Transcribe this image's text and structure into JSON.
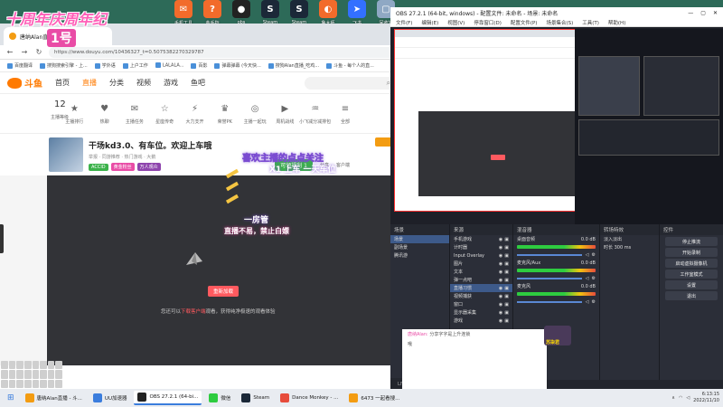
{
  "desktop_icons": [
    {
      "label": "手机工具",
      "color": "#f26b2b",
      "glyph": "✉"
    },
    {
      "label": "金手指",
      "color": "#f26b2b",
      "glyph": "?"
    },
    {
      "label": "obs",
      "color": "#222",
      "glyph": "●"
    },
    {
      "label": "Steam",
      "color": "#1b2838",
      "glyph": "S"
    },
    {
      "label": "Steam",
      "color": "#1b2838",
      "glyph": "S"
    },
    {
      "label": "鲁大师",
      "color": "#f26b2b",
      "glyph": "◐"
    },
    {
      "label": "飞书",
      "color": "#3370ff",
      "glyph": "➤"
    },
    {
      "label": "回收站",
      "color": "#8fa8c4",
      "glyph": "▢"
    }
  ],
  "browser": {
    "overlay_title": "十周年庆周年纪",
    "overlay_badge": "1号",
    "tab_title": "唐纳Alan直播 - 斗鱼",
    "url": "https://www.douyu.com/10436327_t=0.5075382270329787",
    "bookmarks": [
      "百度翻译",
      "搜狗搜索引擎 - 上...",
      "学外语",
      "上户工作",
      "LALALA...",
      "百影",
      "弹幕弹幕 (今天快...",
      "搜狗Alan直播_吃鸡...",
      "斗鱼 - 每个人的直..."
    ]
  },
  "site": {
    "logo": "斗鱼",
    "nav": [
      "首页",
      "直播",
      "分类",
      "视频",
      "游戏",
      "鱼吧"
    ],
    "categories": [
      {
        "label": "主播排行",
        "glyph": "★"
      },
      {
        "label": "热聊",
        "glyph": "♥"
      },
      {
        "label": "主播任务",
        "glyph": "✉"
      },
      {
        "label": "星座传奇",
        "glyph": "☆"
      },
      {
        "label": "大力支开",
        "glyph": "⚡"
      },
      {
        "label": "荣誉PK",
        "glyph": "♛"
      },
      {
        "label": "主播一起玩",
        "glyph": "◎"
      },
      {
        "label": "周机战线",
        "glyph": "▶"
      },
      {
        "label": "小飞减分减排包",
        "glyph": "♒"
      },
      {
        "label": "全部",
        "glyph": "≡"
      }
    ],
    "level_num": "12",
    "level_label": "主播等级"
  },
  "room": {
    "title": "干场kd3.0、有车位。欢迎上车哦",
    "meta1": "举报 · 同游推荐 · 热门游戏 · 大鹅",
    "badges": [
      {
        "text": "ACCID",
        "color": "#3bb24a"
      },
      {
        "text": "黄金粉丝",
        "color": "#e94ca6"
      },
      {
        "text": "万人观众",
        "color": "#8e44ad"
      }
    ],
    "follow_label": "可领福利 1",
    "share": "分享",
    "more": "客户端"
  },
  "player": {
    "play_btn": "重新加载",
    "tip_before": "您还可以",
    "tip_highlight": "下载客户端",
    "tip_after": "观看，获得纯净极速的观看体验"
  },
  "obs": {
    "title": "OBS 27.2.1 (64-bit, windows) - 配置文件: 未命名 - 场景: 未命名",
    "menu": [
      "文件(F)",
      "编辑(E)",
      "视图(V)",
      "停靠窗口(D)",
      "配置文件(P)",
      "场景集合(S)",
      "工具(T)",
      "帮助(H)"
    ],
    "overlay1": "喜欢主播的点点关注",
    "overlay2": "X1 上车 一天车位",
    "overlay3": "一房管",
    "overlay4": "直播不易，禁止白嫖",
    "docks": {
      "scenes_head": "场景",
      "scenes": [
        "场景",
        "副场景",
        "腾讯游"
      ],
      "sources_head": "来源",
      "sources": [
        "手机游戏",
        "计时器",
        "Input Overlay",
        "图片",
        "文本",
        "弹一点吧",
        "直播习惯",
        "视频捕获",
        "窗口",
        "显示器采集",
        "游戏"
      ],
      "mixer_head": "混音器",
      "mixer": [
        {
          "name": "桌面音频",
          "db": "0.0 dB"
        },
        {
          "name": "麦克风/Aux",
          "db": "0.0 dB"
        },
        {
          "name": "麦克风",
          "db": "0.0 dB"
        }
      ],
      "transition_head": "转场特效",
      "transition_type": "淡入淡出",
      "duration_label": "时长",
      "duration_value": "300 ms",
      "controls_head": "控件",
      "controls": [
        "停止推流",
        "开始录制",
        "启动虚拟摄像机",
        "工作室模式",
        "设置",
        "退出"
      ]
    },
    "status": [
      "LIVE: 00:00:00",
      "REC: 00:00:00",
      "CPU: 6.0%, 60.00 fps"
    ]
  },
  "chat": {
    "row1_user": "唐纳Alan:",
    "row1_text": "分享字字是上升连锁",
    "row2_text": "哦"
  },
  "avatar_label": "苏柒君",
  "taskbar": {
    "items": [
      {
        "label": "唐纳Alan直播 - 斗...",
        "color": "#f39c12",
        "active": false
      },
      {
        "label": "UU加速器",
        "color": "#3b7ddd",
        "active": false
      },
      {
        "label": "OBS 27.2.1 (64-bi...",
        "color": "#222",
        "active": true
      },
      {
        "label": "微信",
        "color": "#2ecc40",
        "active": false
      },
      {
        "label": "Steam",
        "color": "#1b2838",
        "active": false
      },
      {
        "label": "Dance Monkey - ...",
        "color": "#e74c3c",
        "active": false
      },
      {
        "label": "6473 一起看搜...",
        "color": "#f39c12",
        "active": false
      }
    ],
    "time": "6:13:15",
    "date": "2022/11/10"
  }
}
